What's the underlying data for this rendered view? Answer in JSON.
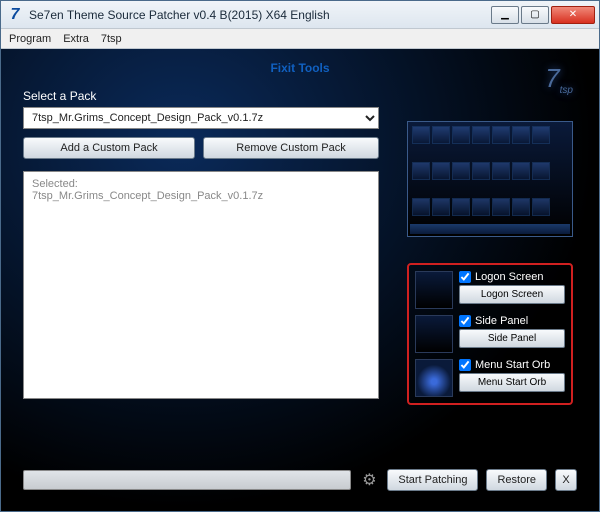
{
  "title": "Se7en Theme Source Patcher v0.4 B(2015) X64 English",
  "menu": {
    "program": "Program",
    "extra": "Extra",
    "tsp": "7tsp"
  },
  "header_link": "Fixit Tools",
  "logo": {
    "big": "7",
    "small": "tsp"
  },
  "pack": {
    "label": "Select a Pack",
    "selected": "7tsp_Mr.Grims_Concept_Design_Pack_v0.1.7z",
    "add_btn": "Add a Custom Pack",
    "remove_btn": "Remove Custom Pack"
  },
  "selected_info": {
    "heading": "Selected:",
    "line": "7tsp_Mr.Grims_Concept_Design_Pack_v0.1.7z"
  },
  "options": {
    "logon": {
      "check": "Logon Screen",
      "btn": "Logon Screen",
      "checked": true
    },
    "side": {
      "check": "Side Panel",
      "btn": "Side Panel",
      "checked": true
    },
    "orb": {
      "check": "Menu Start Orb",
      "btn": "Menu Start Orb",
      "checked": true
    }
  },
  "bottom": {
    "start": "Start Patching",
    "restore": "Restore",
    "x": "X"
  }
}
